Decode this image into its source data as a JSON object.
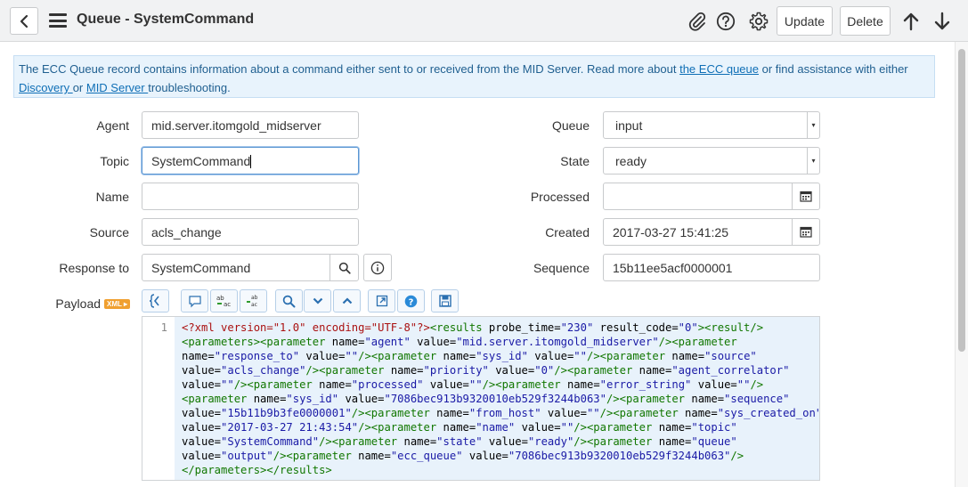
{
  "header": {
    "title": "Queue - SystemCommand",
    "update_label": "Update",
    "delete_label": "Delete"
  },
  "info": {
    "text1": "The ECC Queue record contains information about a command either sent to or received from the MID Server. Read more about ",
    "link1": "the ECC queue",
    "text2": " or find assistance with either ",
    "link2": "Discovery ",
    "text3": "or ",
    "link3": "MID Server ",
    "text4": "troubleshooting."
  },
  "form": {
    "agent_label": "Agent",
    "agent_value": "mid.server.itomgold_midserver",
    "topic_label": "Topic",
    "topic_value": "SystemCommand",
    "name_label": "Name",
    "name_value": "",
    "source_label": "Source",
    "source_value": "acls_change",
    "response_label": "Response to",
    "response_value": "SystemCommand",
    "queue_label": "Queue",
    "queue_value": "input",
    "state_label": "State",
    "state_value": "ready",
    "processed_label": "Processed",
    "processed_value": "",
    "created_label": "Created",
    "created_value": "2017-03-27 15:41:25",
    "sequence_label": "Sequence",
    "sequence_value": "15b11ee5acf0000001",
    "payload_label": "Payload",
    "xml_badge": "XML ▸"
  },
  "editor": {
    "line_number": "1",
    "lines": [
      [
        [
          "pi",
          "<?xml version=\"1.0\" encoding=\"UTF-8\"?>"
        ],
        [
          "tag",
          "<results "
        ],
        [
          "attr",
          "probe_time="
        ],
        [
          "val",
          "\"230\""
        ],
        [
          "attr",
          " result_code="
        ],
        [
          "val",
          "\"0\""
        ],
        [
          "tag",
          "><result/>"
        ]
      ],
      [
        [
          "tag",
          "<parameters><parameter "
        ],
        [
          "attr",
          "name="
        ],
        [
          "val",
          "\"agent\""
        ],
        [
          "attr",
          " value="
        ],
        [
          "val",
          "\"mid.server.itomgold_midserver\""
        ],
        [
          "tag",
          "/><parameter"
        ]
      ],
      [
        [
          "attr",
          "name="
        ],
        [
          "val",
          "\"response_to\""
        ],
        [
          "attr",
          " value="
        ],
        [
          "val",
          "\"\""
        ],
        [
          "tag",
          "/><parameter "
        ],
        [
          "attr",
          "name="
        ],
        [
          "val",
          "\"sys_id\""
        ],
        [
          "attr",
          " value="
        ],
        [
          "val",
          "\"\""
        ],
        [
          "tag",
          "/><parameter "
        ],
        [
          "attr",
          "name="
        ],
        [
          "val",
          "\"source\""
        ]
      ],
      [
        [
          "attr",
          "value="
        ],
        [
          "val",
          "\"acls_change\""
        ],
        [
          "tag",
          "/><parameter "
        ],
        [
          "attr",
          "name="
        ],
        [
          "val",
          "\"priority\""
        ],
        [
          "attr",
          " value="
        ],
        [
          "val",
          "\"0\""
        ],
        [
          "tag",
          "/><parameter "
        ],
        [
          "attr",
          "name="
        ],
        [
          "val",
          "\"agent_correlator\""
        ]
      ],
      [
        [
          "attr",
          "value="
        ],
        [
          "val",
          "\"\""
        ],
        [
          "tag",
          "/><parameter "
        ],
        [
          "attr",
          "name="
        ],
        [
          "val",
          "\"processed\""
        ],
        [
          "attr",
          " value="
        ],
        [
          "val",
          "\"\""
        ],
        [
          "tag",
          "/><parameter "
        ],
        [
          "attr",
          "name="
        ],
        [
          "val",
          "\"error_string\""
        ],
        [
          "attr",
          " value="
        ],
        [
          "val",
          "\"\""
        ],
        [
          "tag",
          "/>"
        ]
      ],
      [
        [
          "tag",
          "<parameter "
        ],
        [
          "attr",
          "name="
        ],
        [
          "val",
          "\"sys_id\""
        ],
        [
          "attr",
          " value="
        ],
        [
          "val",
          "\"7086bec913b9320010eb529f3244b063\""
        ],
        [
          "tag",
          "/><parameter "
        ],
        [
          "attr",
          "name="
        ],
        [
          "val",
          "\"sequence\""
        ]
      ],
      [
        [
          "attr",
          "value="
        ],
        [
          "val",
          "\"15b11b9b3fe0000001\""
        ],
        [
          "tag",
          "/><parameter "
        ],
        [
          "attr",
          "name="
        ],
        [
          "val",
          "\"from_host\""
        ],
        [
          "attr",
          " value="
        ],
        [
          "val",
          "\"\""
        ],
        [
          "tag",
          "/><parameter "
        ],
        [
          "attr",
          "name="
        ],
        [
          "val",
          "\"sys_created_on\""
        ]
      ],
      [
        [
          "attr",
          "value="
        ],
        [
          "val",
          "\"2017-03-27 21:43:54\""
        ],
        [
          "tag",
          "/><parameter "
        ],
        [
          "attr",
          "name="
        ],
        [
          "val",
          "\"name\""
        ],
        [
          "attr",
          " value="
        ],
        [
          "val",
          "\"\""
        ],
        [
          "tag",
          "/><parameter "
        ],
        [
          "attr",
          "name="
        ],
        [
          "val",
          "\"topic\""
        ]
      ],
      [
        [
          "attr",
          "value="
        ],
        [
          "val",
          "\"SystemCommand\""
        ],
        [
          "tag",
          "/><parameter "
        ],
        [
          "attr",
          "name="
        ],
        [
          "val",
          "\"state\""
        ],
        [
          "attr",
          " value="
        ],
        [
          "val",
          "\"ready\""
        ],
        [
          "tag",
          "/><parameter "
        ],
        [
          "attr",
          "name="
        ],
        [
          "val",
          "\"queue\""
        ]
      ],
      [
        [
          "attr",
          "value="
        ],
        [
          "val",
          "\"output\""
        ],
        [
          "tag",
          "/><parameter "
        ],
        [
          "attr",
          "name="
        ],
        [
          "val",
          "\"ecc_queue\""
        ],
        [
          "attr",
          " value="
        ],
        [
          "val",
          "\"7086bec913b9320010eb529f3244b063\""
        ],
        [
          "tag",
          "/>"
        ]
      ],
      [
        [
          "tag",
          "</parameters></results>"
        ]
      ]
    ]
  }
}
